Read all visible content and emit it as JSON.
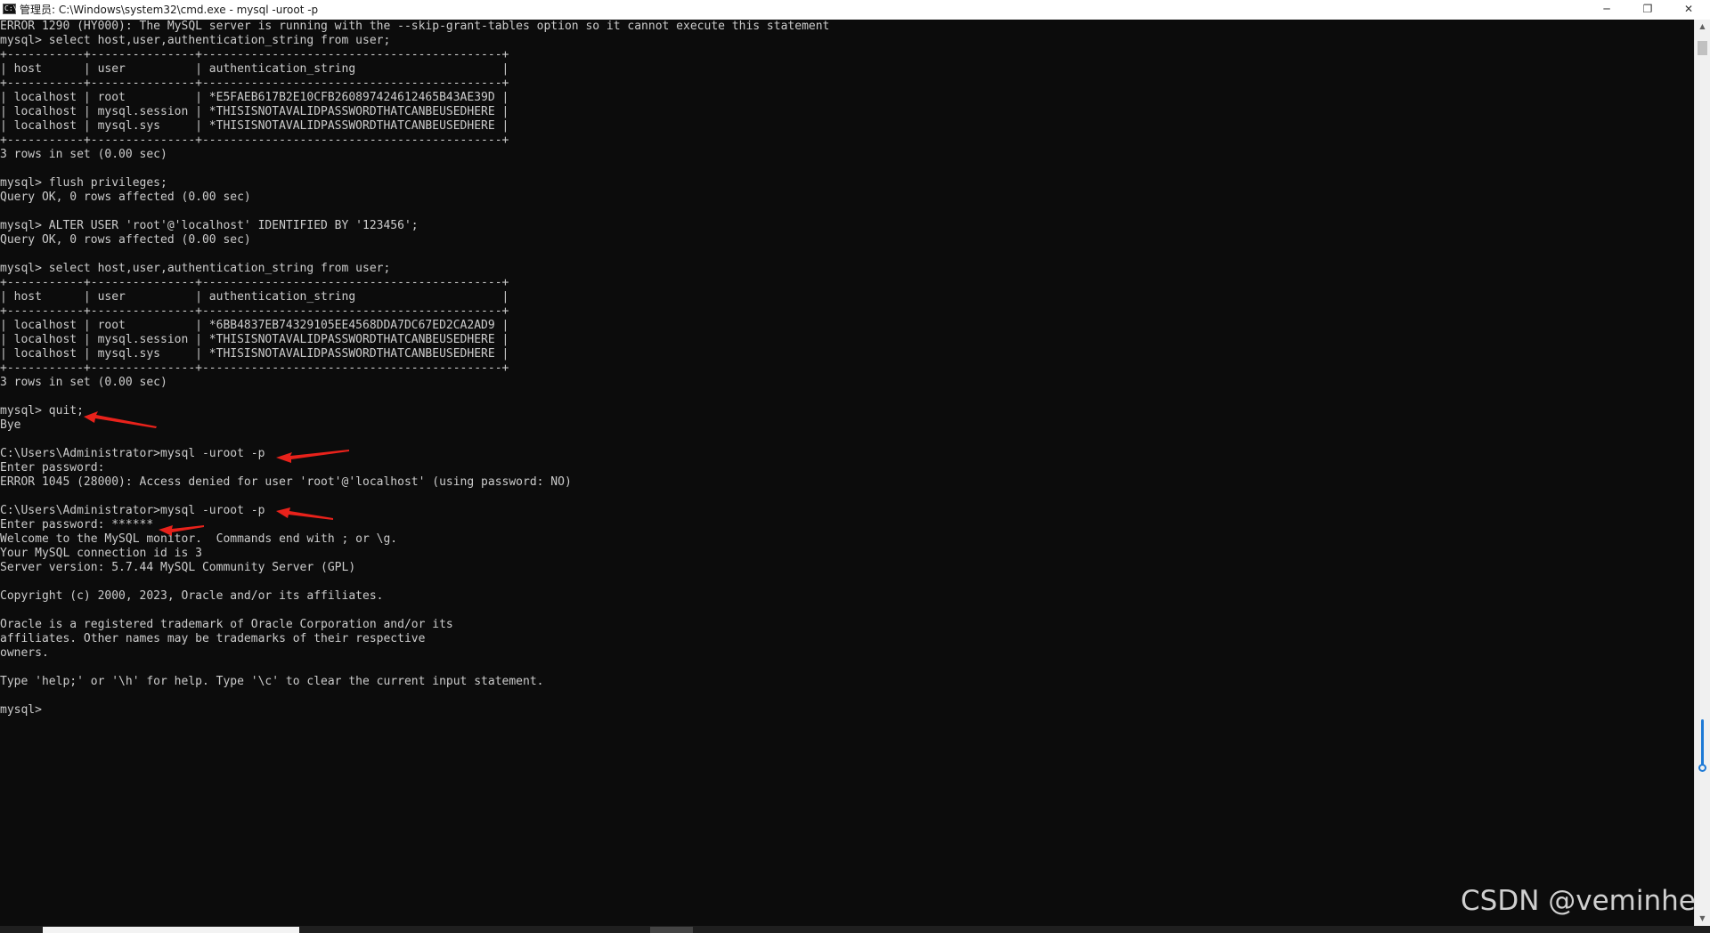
{
  "window": {
    "title": "管理员: C:\\Windows\\system32\\cmd.exe - mysql  -uroot -p",
    "icon_label": "C:\\",
    "controls": {
      "minimize": "─",
      "maximize": "❐",
      "close": "✕"
    }
  },
  "console": {
    "lines": [
      "ERROR 1290 (HY000): The MySQL server is running with the --skip-grant-tables option so it cannot execute this statement",
      "mysql> select host,user,authentication_string from user;",
      "+-----------+---------------+-------------------------------------------+",
      "| host      | user          | authentication_string                     |",
      "+-----------+---------------+-------------------------------------------+",
      "| localhost | root          | *E5FAEB617B2E10CFB260897424612465B43AE39D |",
      "| localhost | mysql.session | *THISISNOTAVALIDPASSWORDTHATCANBEUSEDHERE |",
      "| localhost | mysql.sys     | *THISISNOTAVALIDPASSWORDTHATCANBEUSEDHERE |",
      "+-----------+---------------+-------------------------------------------+",
      "3 rows in set (0.00 sec)",
      "",
      "mysql> flush privileges;",
      "Query OK, 0 rows affected (0.00 sec)",
      "",
      "mysql> ALTER USER 'root'@'localhost' IDENTIFIED BY '123456';",
      "Query OK, 0 rows affected (0.00 sec)",
      "",
      "mysql> select host,user,authentication_string from user;",
      "+-----------+---------------+-------------------------------------------+",
      "| host      | user          | authentication_string                     |",
      "+-----------+---------------+-------------------------------------------+",
      "| localhost | root          | *6BB4837EB74329105EE4568DDA7DC67ED2CA2AD9 |",
      "| localhost | mysql.session | *THISISNOTAVALIDPASSWORDTHATCANBEUSEDHERE |",
      "| localhost | mysql.sys     | *THISISNOTAVALIDPASSWORDTHATCANBEUSEDHERE |",
      "+-----------+---------------+-------------------------------------------+",
      "3 rows in set (0.00 sec)",
      "",
      "mysql> quit;",
      "Bye",
      "",
      "C:\\Users\\Administrator>mysql -uroot -p",
      "Enter password:",
      "ERROR 1045 (28000): Access denied for user 'root'@'localhost' (using password: NO)",
      "",
      "C:\\Users\\Administrator>mysql -uroot -p",
      "Enter password: ******",
      "Welcome to the MySQL monitor.  Commands end with ; or \\g.",
      "Your MySQL connection id is 3",
      "Server version: 5.7.44 MySQL Community Server (GPL)",
      "",
      "Copyright (c) 2000, 2023, Oracle and/or its affiliates.",
      "",
      "Oracle is a registered trademark of Oracle Corporation and/or its",
      "affiliates. Other names may be trademarks of their respective",
      "owners.",
      "",
      "Type 'help;' or '\\h' for help. Type '\\c' to clear the current input statement.",
      "",
      "mysql>"
    ]
  },
  "scrollbar": {
    "up_arrow": "▲",
    "down_arrow": "▼"
  },
  "watermark": "CSDN @veminhe",
  "colors": {
    "console_bg": "#0c0c0c",
    "console_text": "#cccccc",
    "annotation_arrow": "#e8221b",
    "scroll_indicator": "#1e7ad6"
  }
}
